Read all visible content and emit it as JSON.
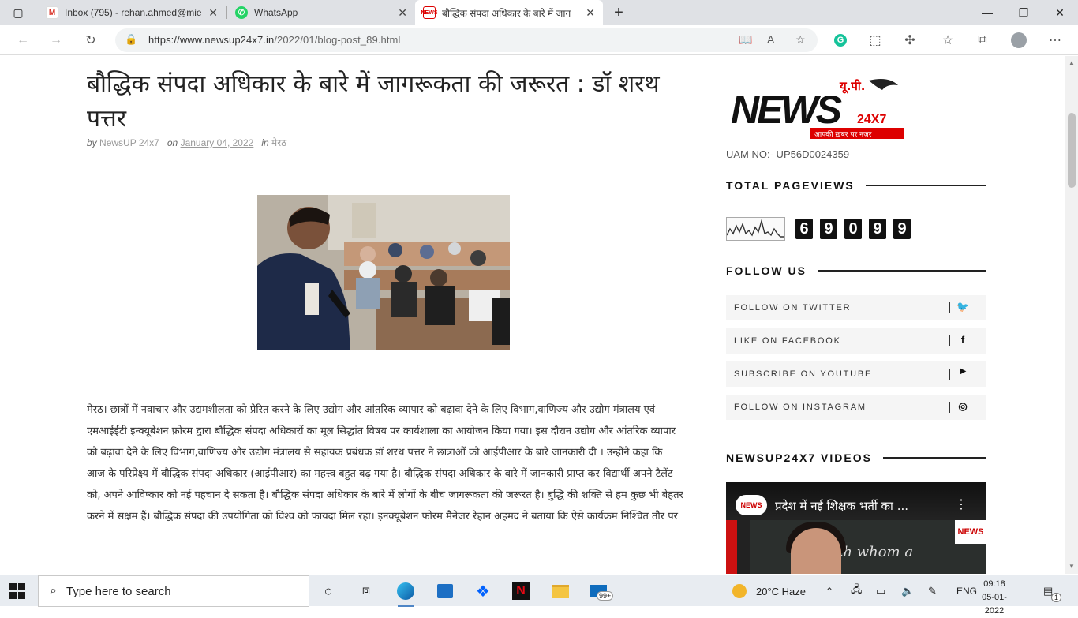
{
  "tabs": [
    {
      "title": "Inbox (795) - rehan.ahmed@mie",
      "icon": "gmail-icon"
    },
    {
      "title": "WhatsApp",
      "icon": "whatsapp-icon"
    },
    {
      "title": "बौद्धिक संपदा अधिकार के बारे में जाग",
      "icon": "newsup-favicon",
      "active": true
    }
  ],
  "address_bar": {
    "url_prefix": "https://www.newsup24x7.in",
    "url_path": "/2022/01/blog-post_89.html"
  },
  "post": {
    "title": "बौद्धिक संपदा अधिकार के बारे में जागरूकता की जरूरत : डॉ शरथ पत्तर",
    "by": "by",
    "author": "NewsUP 24x7",
    "on": "on",
    "date": "January 04, 2022",
    "in": "in",
    "category": "मेरठ",
    "body": "मेरठ। छात्रों में नवाचार और उद्यमशीलता को प्रेरित करने के लिए उद्योग और आंतरिक व्यापार को बढ़ावा देने के लिए विभाग,वाणिज्य और उद्योग मंत्रालय एवं एमआईईटी इन्क्यूबेशन फ़ोरम द्वारा बौद्धिक संपदा अधिकारों का मूल सिद्धांत विषय पर कार्यशाला का आयोजन किया गया। इस दौरान उद्योग और आंतरिक व्यापार को बढ़ावा देने के लिए विभाग,वाणिज्य और उद्योग मंत्रालय से सहायक प्रबंधक डॉ शरथ पत्तर ने छात्राओं को आईपीआर के बारे जानकारी दी । उन्होंने कहा कि आज के परिप्रेक्ष्य में बौद्धिक संपदा अधिकार (आईपीआर) का महत्त्व बहुत बढ़ गया है। बौद्धिक संपदा अधिकार के बारे में जानकारी प्राप्त कर विद्यार्थी अपने टैलेंट को, अपने आविष्कार को नई पहचान दे सकता है। बौद्धिक संपदा अधिकार के बारे में लोगों के बीच जागरूकता की जरूरत है। बुद्धि की शक्ति से हम कुछ भी बेहतर करने में सक्षम हैं। बौद्धिक संपदा की उपयोगिता को विश्व को फायदा मिल रहा। इनक्यूबेशन फोरम मैनेजर रेहान अहमद ने बताया कि ऐसे कार्यक्रम निश्चित तौर पर"
  },
  "sidebar": {
    "logo": {
      "top": "यू.पी.",
      "main": "NEWS",
      "num": "24X7",
      "tagline": "आपकी ख़बर पर नज़र"
    },
    "uam": "UAM NO:- UP56D0024359",
    "pageviews_title": "TOTAL PAGEVIEWS",
    "pageviews_digits": [
      "6",
      "9",
      "0",
      "9",
      "9"
    ],
    "follow_title": "FOLLOW US",
    "follow": [
      {
        "label": "FOLLOW ON TWITTER",
        "icon": "twitter-icon",
        "glyph": "🐦"
      },
      {
        "label": "LIKE ON FACEBOOK",
        "icon": "facebook-icon",
        "glyph": "f"
      },
      {
        "label": "SUBSCRIBE ON YOUTUBE",
        "icon": "youtube-icon",
        "glyph": "▶"
      },
      {
        "label": "FOLLOW ON INSTAGRAM",
        "icon": "instagram-icon",
        "glyph": "◎"
      }
    ],
    "videos_title": "NEWSUP24X7 VIDEOS",
    "video_title": "प्रदेश में नई शिक्षक भर्ती का ...",
    "video_chalk": "with whom a"
  },
  "taskbar": {
    "search_placeholder": "Type here to search",
    "weather": "20°C  Haze",
    "language": "ENG",
    "time": "09:18",
    "date": "05-01-2022",
    "mail_badge": "99+",
    "notification_count": "1"
  }
}
